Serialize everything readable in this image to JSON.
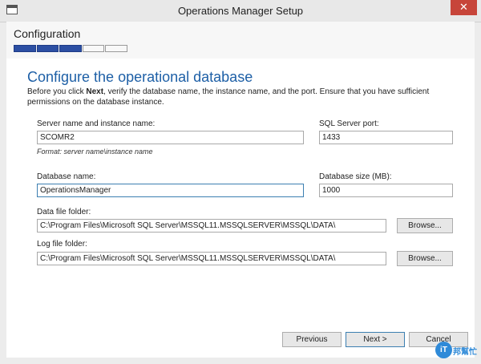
{
  "window": {
    "title": "Operations Manager Setup",
    "close_glyph": "✕"
  },
  "header": {
    "title": "Configuration",
    "progress": {
      "total_steps": 5,
      "completed_steps": 3
    }
  },
  "page": {
    "title": "Configure the operational database",
    "intro_prefix": "Before you click ",
    "intro_bold": "Next",
    "intro_suffix": ", verify the database name, the instance name, and the port. Ensure that you have sufficient permissions on the database instance."
  },
  "form": {
    "server_name_label": "Server name and instance name:",
    "server_name_value": "SCOMR2",
    "server_format_hint": "Format: server name\\instance name",
    "sql_port_label": "SQL Server port:",
    "sql_port_value": "1433",
    "db_name_label": "Database name:",
    "db_name_value": "OperationsManager",
    "db_size_label": "Database size (MB):",
    "db_size_value": "1000",
    "data_folder_label": "Data file folder:",
    "data_folder_value": "C:\\Program Files\\Microsoft SQL Server\\MSSQL11.MSSQLSERVER\\MSSQL\\DATA\\",
    "log_folder_label": "Log file folder:",
    "log_folder_value": "C:\\Program Files\\Microsoft SQL Server\\MSSQL11.MSSQLSERVER\\MSSQL\\DATA\\",
    "browse_label": "Browse..."
  },
  "footer": {
    "previous_label": "Previous",
    "next_label": "Next >",
    "cancel_label": "Cancel"
  },
  "watermark": {
    "logo_text": "iT",
    "site_text": "邦幫忙"
  },
  "colors": {
    "accent": "#1d5fa6",
    "progress": "#2c4fa3",
    "close": "#c7453a"
  }
}
